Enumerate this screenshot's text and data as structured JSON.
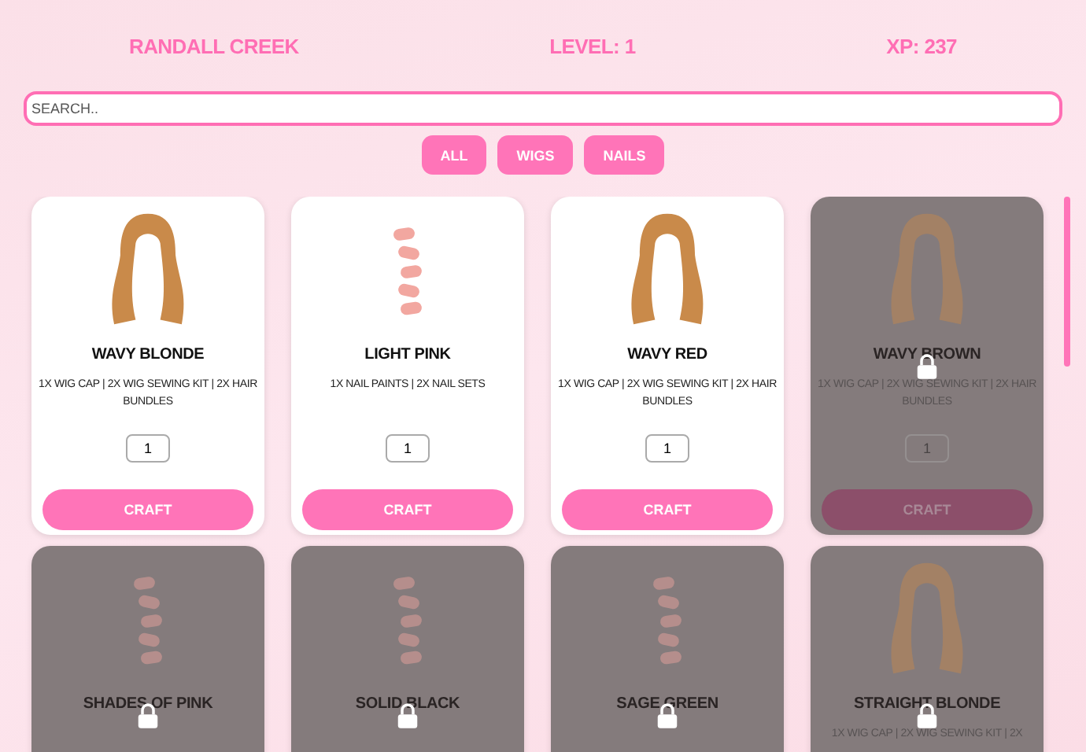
{
  "header": {
    "name": "RANDALL CREEK",
    "level": "LEVEL: 1",
    "xp": "XP: 237"
  },
  "search": {
    "placeholder": "SEARCH.."
  },
  "filters": [
    {
      "label": "ALL"
    },
    {
      "label": "WIGS"
    },
    {
      "label": "NAILS"
    }
  ],
  "items": [
    {
      "kind": "wig",
      "name": "WAVY BLONDE",
      "description": "1X WIG CAP | 2X WIG SEWING KIT | 2X HAIR BUNDLES",
      "quantity": "1",
      "button": "CRAFT",
      "locked": false
    },
    {
      "kind": "nails",
      "name": "LIGHT PINK",
      "description": "1X NAIL PAINTS | 2X NAIL SETS",
      "quantity": "1",
      "button": "CRAFT",
      "locked": false
    },
    {
      "kind": "wig",
      "name": "WAVY RED",
      "description": "1X WIG CAP | 2X WIG SEWING KIT | 2X HAIR BUNDLES",
      "quantity": "1",
      "button": "CRAFT",
      "locked": false
    },
    {
      "kind": "wig",
      "name": "WAVY BROWN",
      "description": "1X WIG CAP | 2X WIG SEWING KIT | 2X HAIR BUNDLES",
      "quantity": "1",
      "button": "CRAFT",
      "locked": true
    },
    {
      "kind": "nails",
      "name": "SHADES OF PINK",
      "locked": true
    },
    {
      "kind": "nails",
      "name": "SOLID BLACK",
      "locked": true
    },
    {
      "kind": "nails",
      "name": "SAGE GREEN",
      "locked": true
    },
    {
      "kind": "wig",
      "name": "STRAIGHT BLONDE",
      "description": "1X WIG CAP | 2X WIG SEWING KIT | 2X",
      "locked": true
    }
  ]
}
